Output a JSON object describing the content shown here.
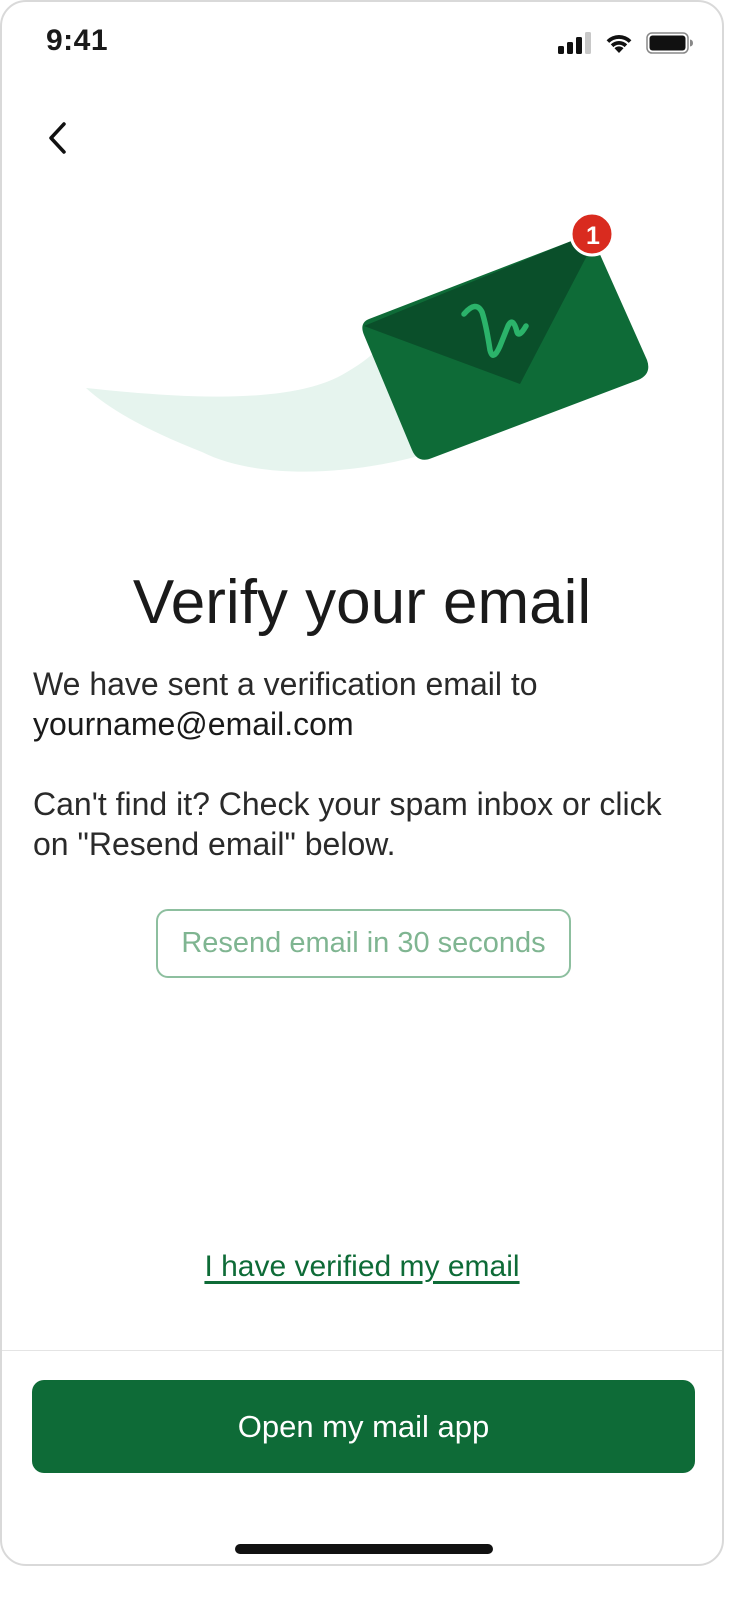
{
  "status_bar": {
    "time": "9:41",
    "icons": [
      "cellular-signal-icon",
      "wifi-icon",
      "battery-icon"
    ]
  },
  "navigation": {
    "back_icon": "chevron-left-icon"
  },
  "illustration": {
    "icon": "envelope-icon",
    "badge_count": "1",
    "colors": {
      "envelope": "#0e6b37",
      "envelope_flap": "#0a4f2a",
      "logo_stroke": "#2bb36a",
      "badge": "#d92b1f",
      "trail": "#e6f4ee"
    }
  },
  "content": {
    "title": "Verify your email",
    "sent_text": "We have sent a verification email to",
    "email": "yourname@email.com",
    "hint_text": "Can't find it? Check your spam inbox or click on \"Resend email\" below.",
    "resend_label": "Resend email in 30 seconds",
    "verified_link": "I have verified my email"
  },
  "footer": {
    "primary_label": "Open my mail app"
  },
  "colors": {
    "primary": "#0e6b37",
    "resend_border": "#8dbf9f",
    "resend_text": "#7fb591"
  }
}
